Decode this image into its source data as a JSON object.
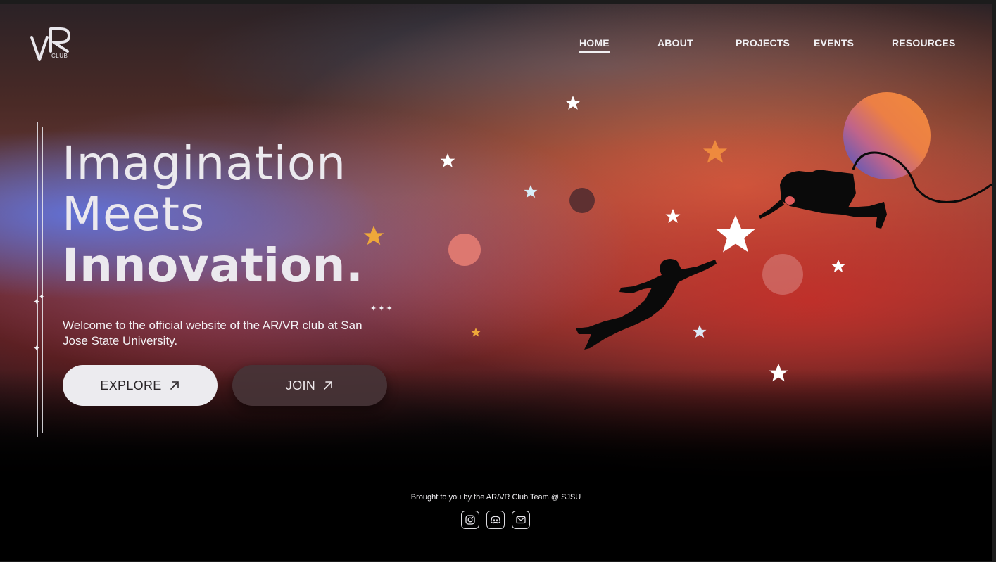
{
  "logo": {
    "mark": "VR",
    "sub": "CLUB"
  },
  "nav": [
    {
      "label": "HOME",
      "active": true
    },
    {
      "label": "ABOUT",
      "active": false
    },
    {
      "label": "PROJECTS",
      "active": false
    },
    {
      "label": "EVENTS",
      "active": false
    },
    {
      "label": "RESOURCES",
      "active": false
    }
  ],
  "hero": {
    "line1": "Imagination",
    "line2": "Meets",
    "line3": "Innovation.",
    "subtitle": "Welcome to the official website of the AR/VR club at San Jose State University.",
    "explore_label": "EXPLORE",
    "join_label": "JOIN"
  },
  "footer": {
    "credit": "Brought to you by the AR/VR Club Team @ SJSU",
    "icons": [
      "instagram-icon",
      "discord-icon",
      "mail-icon"
    ]
  },
  "colors": {
    "accent_orange": "#f08a3c",
    "accent_blue": "#5e6fd6",
    "text_light": "#ebe9ee"
  }
}
